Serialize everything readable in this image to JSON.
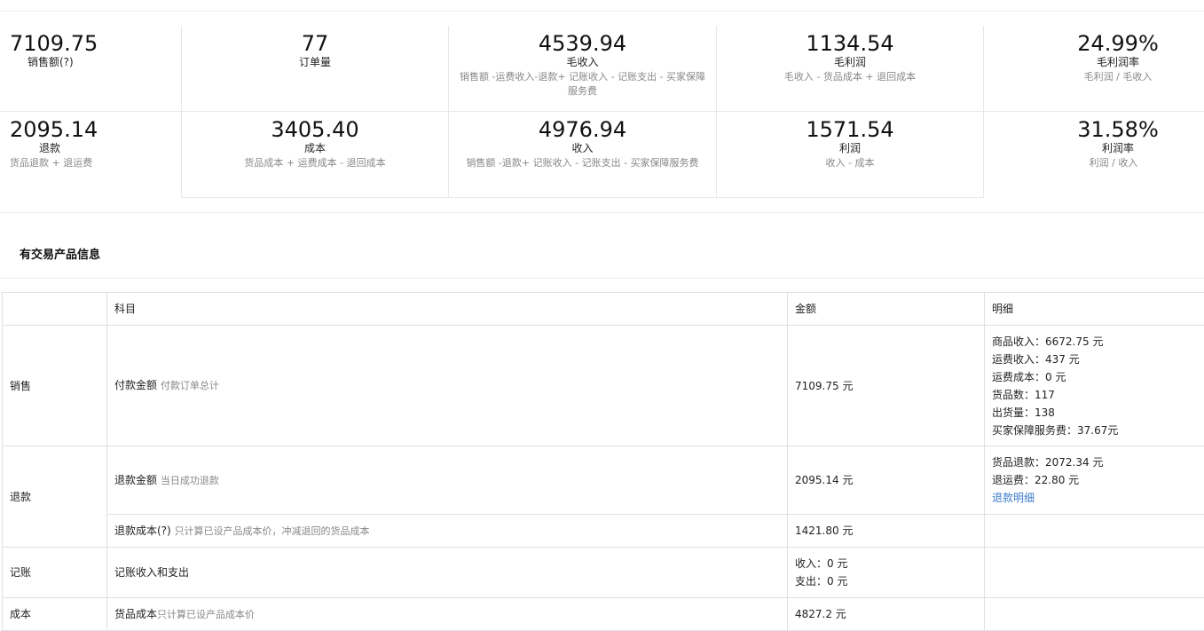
{
  "stats": [
    {
      "value": "7109.75",
      "label": "销售额(?)",
      "desc": ""
    },
    {
      "value": "77",
      "label": "订单量",
      "desc": ""
    },
    {
      "value": "4539.94",
      "label": "毛收入",
      "desc": "销售额 -运费收入-退款+ 记账收入 - 记账支出 - 买家保障服务费"
    },
    {
      "value": "1134.54",
      "label": "毛利润",
      "desc": "毛收入 - 货品成本 + 退回成本"
    },
    {
      "value": "24.99%",
      "label": "毛利润率",
      "desc": "毛利润 / 毛收入"
    },
    {
      "value": "2095.14",
      "label": "退款",
      "desc": "货品退款 + 退运费"
    },
    {
      "value": "3405.40",
      "label": "成本",
      "desc": "货品成本 + 运费成本 - 退回成本"
    },
    {
      "value": "4976.94",
      "label": "收入",
      "desc": "销售额 -退款+ 记账收入 - 记账支出 - 买家保障服务费"
    },
    {
      "value": "1571.54",
      "label": "利润",
      "desc": "收入 - 成本"
    },
    {
      "value": "31.58%",
      "label": "利润率",
      "desc": "利润 / 收入"
    }
  ],
  "section_title": "有交易产品信息",
  "table": {
    "headers": [
      "",
      "科目",
      "金额",
      "明细"
    ],
    "sales": {
      "category": "销售",
      "item": "付款金额",
      "item_note": "付款订单总计",
      "amount": "7109.75 元",
      "details": [
        "商品收入：6672.75 元",
        "运费收入：437 元",
        "运费成本：0 元",
        "货品数：117",
        "出货量：138",
        "买家保障服务费：37.67元"
      ]
    },
    "refund": {
      "category": "退款",
      "item": "退款金额",
      "item_note": "当日成功退款",
      "amount": "2095.14 元",
      "details": [
        "货品退款：2072.34 元",
        "退运费：22.80 元"
      ],
      "detail_link": "退款明细",
      "item2": "退款成本(?)",
      "item2_note": "只计算已设产品成本价，冲减退回的货品成本",
      "amount2": "1421.80 元"
    },
    "account": {
      "category": "记账",
      "item": "记账收入和支出",
      "amounts": [
        "收入：0 元",
        "支出：0 元"
      ]
    },
    "cost": {
      "category": "成本",
      "item": "货品成本",
      "item_note": "只计算已设产品成本价",
      "amount": "4827.2 元"
    }
  }
}
